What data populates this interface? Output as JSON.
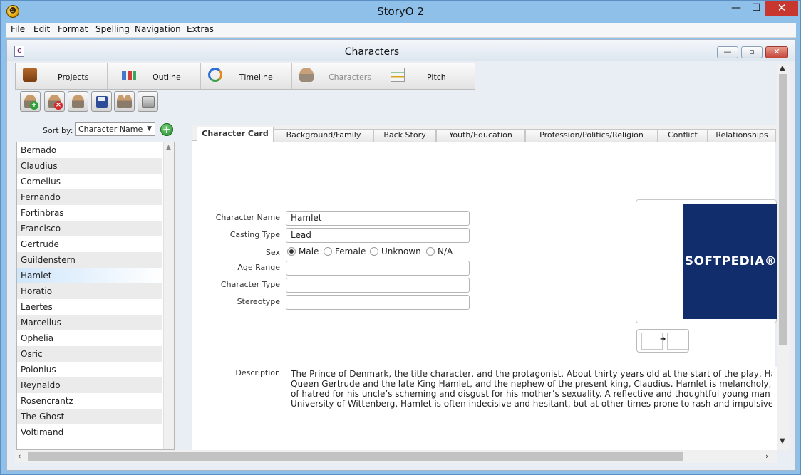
{
  "app": {
    "title": "StoryO 2"
  },
  "menu": [
    "File",
    "Edit",
    "Format",
    "Spelling",
    "Navigation",
    "Extras"
  ],
  "window": {
    "title": "Characters"
  },
  "nav": [
    {
      "label": "Projects",
      "icon": "briefcase-icon"
    },
    {
      "label": "Outline",
      "icon": "outline-icon"
    },
    {
      "label": "Timeline",
      "icon": "timeline-icon"
    },
    {
      "label": "Characters",
      "icon": "character-icon",
      "active": true
    },
    {
      "label": "Pitch",
      "icon": "pitch-icon"
    }
  ],
  "toolbar": {
    "add_badge": "+",
    "delete_badge": "×",
    "icons": [
      "add-character-icon",
      "delete-character-icon",
      "edit-character-icon",
      "save-icon",
      "group-characters-icon",
      "print-icon"
    ]
  },
  "sort": {
    "label": "Sort by:",
    "value": "Character Name",
    "add": "+"
  },
  "characters": [
    "Bernado",
    "Claudius",
    "Cornelius",
    "Fernando",
    "Fortinbras",
    "Francisco",
    "Gertrude",
    "Guildenstern",
    "Hamlet",
    "Horatio",
    "Laertes",
    "Marcellus",
    "Ophelia",
    "Osric",
    "Polonius",
    "Reynaldo",
    "Rosencrantz",
    "The Ghost",
    "Voltimand"
  ],
  "selected_character": "Hamlet",
  "tabs": [
    "Character Card",
    "Background/Family",
    "Back Story",
    "Youth/Education",
    "Profession/Politics/Religion",
    "Conflict",
    "Relationships"
  ],
  "form": {
    "character_name": {
      "label": "Character Name",
      "value": "Hamlet"
    },
    "casting_type": {
      "label": "Casting Type",
      "value": "Lead"
    },
    "sex": {
      "label": "Sex",
      "options": [
        "Male",
        "Female",
        "Unknown",
        "N/A"
      ],
      "selected": "Male"
    },
    "age_range": {
      "label": "Age Range",
      "value": ""
    },
    "character_type": {
      "label": "Character Type",
      "value": ""
    },
    "stereotype": {
      "label": "Stereotype",
      "value": ""
    },
    "description": {
      "label": "Description",
      "lines": [
        "The Prince of Denmark, the title character, and the protagonist. About thirty years old at the start of the play, Hamlet is the so",
        "Queen Gertrude and the late King Hamlet, and the nephew of the present king, Claudius. Hamlet is melancholy, bitter, and cyn",
        "of hatred for his uncle’s scheming and disgust for his mother’s sexuality. A reflective and thoughtful young man who has stud",
        "University of Wittenberg, Hamlet is often indecisive and hesitant, but at other times prone to rash and impulsive acts."
      ]
    }
  },
  "photo": {
    "text": "SOFTPEDIA®"
  },
  "colors": {
    "accent": "#112d6b",
    "selection": "#cfe6fb",
    "close": "#c7372f"
  }
}
